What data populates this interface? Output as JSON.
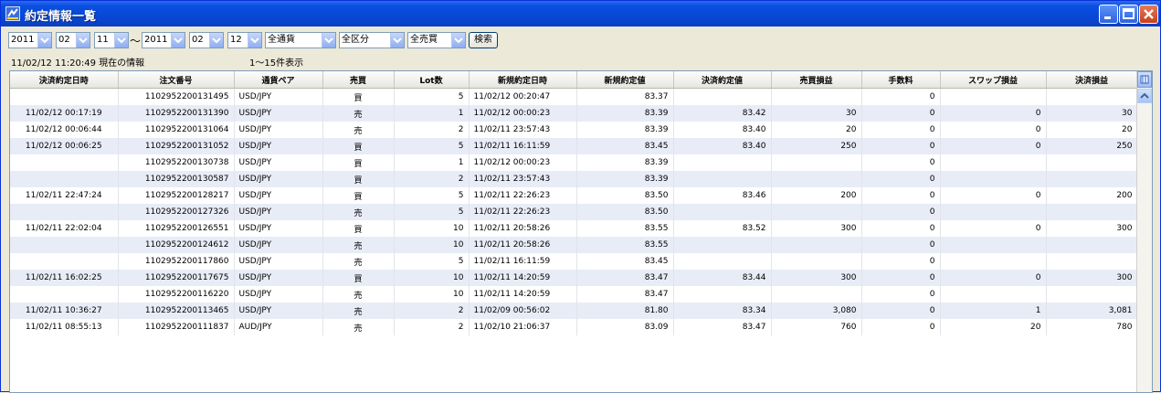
{
  "window": {
    "title": "約定情報一覧"
  },
  "filters": {
    "from_year": "2011",
    "from_month": "02",
    "from_day": "11",
    "tilde": "～",
    "to_year": "2011",
    "to_month": "02",
    "to_day": "12",
    "currency": "全通貨",
    "category": "全区分",
    "side": "全売買",
    "search_label": "検索"
  },
  "status": {
    "timestamp": "11/02/12 11:20:49 現在の情報",
    "count": "1～15件表示"
  },
  "table": {
    "headers": [
      "決済約定日時",
      "注文番号",
      "通貨ペア",
      "売買",
      "Lot数",
      "新規約定日時",
      "新規約定値",
      "決済約定値",
      "売買損益",
      "手数料",
      "スワップ損益",
      "決済損益"
    ],
    "rows": [
      [
        "",
        "1102952200131495",
        "USD/JPY",
        "買",
        "5",
        "11/02/12 00:20:47",
        "83.37",
        "",
        "",
        "0",
        "",
        ""
      ],
      [
        "11/02/12 00:17:19",
        "1102952200131390",
        "USD/JPY",
        "売",
        "1",
        "11/02/12 00:00:23",
        "83.39",
        "83.42",
        "30",
        "0",
        "0",
        "30"
      ],
      [
        "11/02/12 00:06:44",
        "1102952200131064",
        "USD/JPY",
        "売",
        "2",
        "11/02/11 23:57:43",
        "83.39",
        "83.40",
        "20",
        "0",
        "0",
        "20"
      ],
      [
        "11/02/12 00:06:25",
        "1102952200131052",
        "USD/JPY",
        "買",
        "5",
        "11/02/11 16:11:59",
        "83.45",
        "83.40",
        "250",
        "0",
        "0",
        "250"
      ],
      [
        "",
        "1102952200130738",
        "USD/JPY",
        "買",
        "1",
        "11/02/12 00:00:23",
        "83.39",
        "",
        "",
        "0",
        "",
        ""
      ],
      [
        "",
        "1102952200130587",
        "USD/JPY",
        "買",
        "2",
        "11/02/11 23:57:43",
        "83.39",
        "",
        "",
        "0",
        "",
        ""
      ],
      [
        "11/02/11 22:47:24",
        "1102952200128217",
        "USD/JPY",
        "買",
        "5",
        "11/02/11 22:26:23",
        "83.50",
        "83.46",
        "200",
        "0",
        "0",
        "200"
      ],
      [
        "",
        "1102952200127326",
        "USD/JPY",
        "売",
        "5",
        "11/02/11 22:26:23",
        "83.50",
        "",
        "",
        "0",
        "",
        ""
      ],
      [
        "11/02/11 22:02:04",
        "1102952200126551",
        "USD/JPY",
        "買",
        "10",
        "11/02/11 20:58:26",
        "83.55",
        "83.52",
        "300",
        "0",
        "0",
        "300"
      ],
      [
        "",
        "1102952200124612",
        "USD/JPY",
        "売",
        "10",
        "11/02/11 20:58:26",
        "83.55",
        "",
        "",
        "0",
        "",
        ""
      ],
      [
        "",
        "1102952200117860",
        "USD/JPY",
        "売",
        "5",
        "11/02/11 16:11:59",
        "83.45",
        "",
        "",
        "0",
        "",
        ""
      ],
      [
        "11/02/11 16:02:25",
        "1102952200117675",
        "USD/JPY",
        "買",
        "10",
        "11/02/11 14:20:59",
        "83.47",
        "83.44",
        "300",
        "0",
        "0",
        "300"
      ],
      [
        "",
        "1102952200116220",
        "USD/JPY",
        "売",
        "10",
        "11/02/11 14:20:59",
        "83.47",
        "",
        "",
        "0",
        "",
        ""
      ],
      [
        "11/02/11 10:36:27",
        "1102952200113465",
        "USD/JPY",
        "売",
        "2",
        "11/02/09 00:56:02",
        "81.80",
        "83.34",
        "3,080",
        "0",
        "1",
        "3,081"
      ],
      [
        "11/02/11 08:55:13",
        "1102952200111837",
        "AUD/JPY",
        "売",
        "2",
        "11/02/10 21:06:37",
        "83.09",
        "83.47",
        "760",
        "0",
        "20",
        "780"
      ]
    ]
  }
}
